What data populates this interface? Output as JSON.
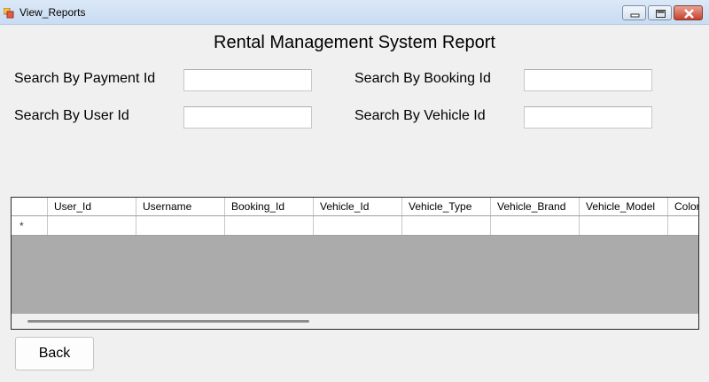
{
  "window": {
    "title": "View_Reports",
    "icon": "winforms-app-icon",
    "controls": [
      "minimize-icon",
      "maximize-icon",
      "close-icon"
    ]
  },
  "report_title": "Rental Management System Report",
  "search": {
    "payment_id_label": "Search By Payment Id",
    "booking_id_label": "Search By Booking Id",
    "user_id_label": "Search By User Id",
    "vehicle_id_label": "Search By Vehicle Id",
    "payment_id_value": "",
    "booking_id_value": "",
    "user_id_value": "",
    "vehicle_id_value": ""
  },
  "grid": {
    "columns": [
      "User_Id",
      "Username",
      "Booking_Id",
      "Vehicle_Id",
      "Vehicle_Type",
      "Vehicle_Brand",
      "Vehicle_Model",
      "Color"
    ],
    "new_row_marker": "*",
    "rows": []
  },
  "buttons": {
    "back_label": "Back"
  },
  "colors": {
    "window_bg": "#f0f0f0",
    "titlebar": "#c9dcf2",
    "grid_empty_bg": "#ababab",
    "close_button": "#c7402c"
  }
}
